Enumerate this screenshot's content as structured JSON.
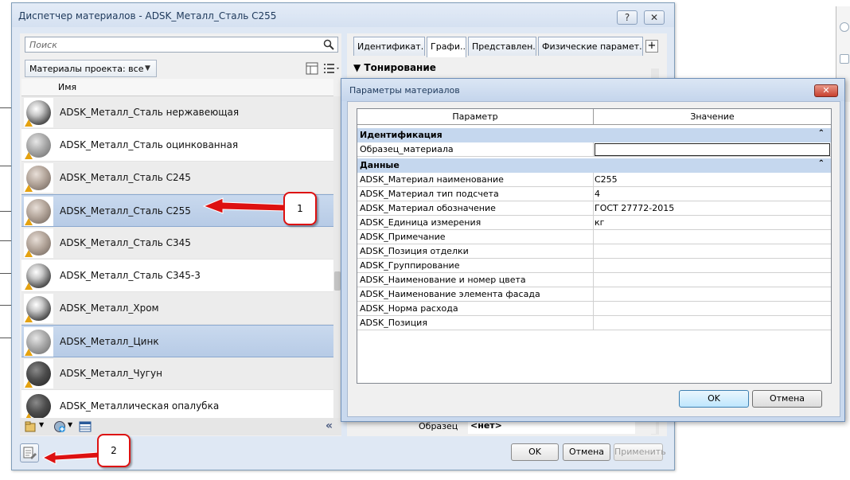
{
  "main_dialog": {
    "title": "Диспетчер материалов - ADSK_Металл_Сталь С255",
    "help_btn": "?",
    "close_btn": "✕",
    "search_placeholder": "Поиск",
    "filter_label": "Материалы проекта: все",
    "list_header": "Имя",
    "materials": [
      {
        "name": "ADSK_Металл_Сталь нержавеющая",
        "state": "alt",
        "tone": "chrome"
      },
      {
        "name": "ADSK_Металл_Сталь оцинкованная",
        "state": "normal",
        "tone": "gray"
      },
      {
        "name": "ADSK_Металл_Сталь С245",
        "state": "alt",
        "tone": "warm"
      },
      {
        "name": "ADSK_Металл_Сталь С255",
        "state": "selected",
        "tone": "warm"
      },
      {
        "name": "ADSK_Металл_Сталь С345",
        "state": "alt",
        "tone": "warm"
      },
      {
        "name": "ADSK_Металл_Сталь С345-3",
        "state": "normal",
        "tone": "chrome"
      },
      {
        "name": "ADSK_Металл_Хром",
        "state": "alt",
        "tone": "chrome"
      },
      {
        "name": "ADSK_Металл_Цинк",
        "state": "selected",
        "tone": "gray"
      },
      {
        "name": "ADSK_Металл_Чугун",
        "state": "alt",
        "tone": "dark"
      },
      {
        "name": "ADSK_Металлическая опалубка",
        "state": "normal",
        "tone": "dark"
      }
    ],
    "tabs": [
      "Идентификат...",
      "Графи...",
      "Представлен...",
      "Физические парамет..."
    ],
    "add_tab": "+",
    "section_title": "Тонирование",
    "sample_label": "Образец",
    "sample_value": "<нет>",
    "ok_label": "OK",
    "cancel_label": "Отмена",
    "apply_label": "Применить"
  },
  "params_dialog": {
    "title": "Параметры материалов",
    "close": "✕",
    "col_param": "Параметр",
    "col_value": "Значение",
    "groups": [
      {
        "title": "Идентификация",
        "chevron": "⌃",
        "rows": [
          {
            "name": "Образец_материала",
            "value": "",
            "editing": true
          }
        ]
      },
      {
        "title": "Данные",
        "chevron": "⌃",
        "rows": [
          {
            "name": "ADSK_Материал наименование",
            "value": "С255"
          },
          {
            "name": "ADSK_Материал тип подсчета",
            "value": "4"
          },
          {
            "name": "ADSK_Материал обозначение",
            "value": "ГОСТ 27772-2015"
          },
          {
            "name": "ADSK_Единица измерения",
            "value": "кг"
          },
          {
            "name": "ADSK_Примечание",
            "value": ""
          },
          {
            "name": "ADSK_Позиция отделки",
            "value": ""
          },
          {
            "name": "ADSK_Группирование",
            "value": ""
          },
          {
            "name": "ADSK_Наименование и номер цвета",
            "value": ""
          },
          {
            "name": "ADSK_Наименование элемента фасада",
            "value": ""
          },
          {
            "name": "ADSK_Норма расхода",
            "value": ""
          },
          {
            "name": "ADSK_Позиция",
            "value": ""
          }
        ]
      }
    ],
    "ok_label": "OK",
    "cancel_label": "Отмена"
  },
  "callouts": [
    "1",
    "2"
  ],
  "colors": {
    "callout_red": "#dd1111",
    "selection": "#b7cbe6",
    "group_header": "#c5d7ee"
  }
}
